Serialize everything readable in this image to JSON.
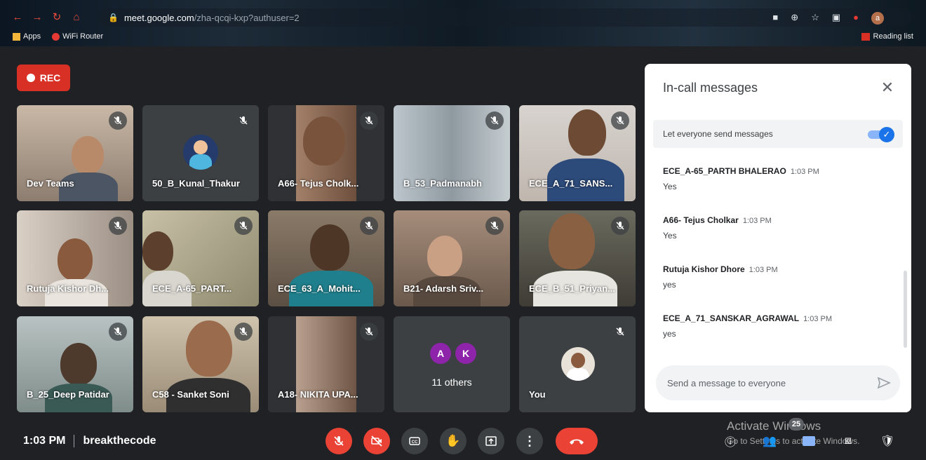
{
  "browser": {
    "url_host": "meet.google.com",
    "url_path": "/zha-qcqi-kxp?authuser=2",
    "bookmarks": [
      "Apps",
      "WiFi Router"
    ],
    "reading_list": "Reading list",
    "profile_initial": "a"
  },
  "rec_label": "REC",
  "tiles": [
    {
      "name": "Dev Teams"
    },
    {
      "name": "50_B_Kunal_Thakur"
    },
    {
      "name": "A66- Tejus Cholk..."
    },
    {
      "name": "B_53_Padmanabh"
    },
    {
      "name": "ECE_A_71_SANS..."
    },
    {
      "name": "Rutuja Kishor Dh..."
    },
    {
      "name": "ECE_A-65_PART..."
    },
    {
      "name": "ECE_63_A_Mohit..."
    },
    {
      "name": "B21- Adarsh Sriv..."
    },
    {
      "name": "ECE_B_51_Priyan..."
    },
    {
      "name": "B_25_Deep Patidar"
    },
    {
      "name": "C58 - Sanket Soni"
    },
    {
      "name": "A18- NIKITA UPA..."
    },
    {
      "name": "You"
    }
  ],
  "others": {
    "initials": [
      "A",
      "K"
    ],
    "label": "11 others"
  },
  "panel": {
    "title": "In-call messages",
    "toggle_label": "Let everyone send messages",
    "messages": [
      {
        "sender": "ECE_A-65_PARTH BHALERAO",
        "time": "1:03 PM",
        "text": "Yes"
      },
      {
        "sender": "A66- Tejus Cholkar",
        "time": "1:03 PM",
        "text": "Yes"
      },
      {
        "sender": "Rutuja Kishor Dhore",
        "time": "1:03 PM",
        "text": "yes"
      },
      {
        "sender": "ECE_A_71_SANSKAR_AGRAWAL",
        "time": "1:03 PM",
        "text": "yes"
      }
    ],
    "input_placeholder": "Send a message to everyone"
  },
  "footer": {
    "time": "1:03 PM",
    "meeting_code": "breakthecode",
    "participants_count": "25",
    "watermark_title": "Activate Windows",
    "watermark_sub": "Go to Settings to activate Windows."
  },
  "colors": {
    "accent": "#1a73e8",
    "danger": "#ea4335",
    "bg": "#202124",
    "tile": "#3c4043"
  }
}
